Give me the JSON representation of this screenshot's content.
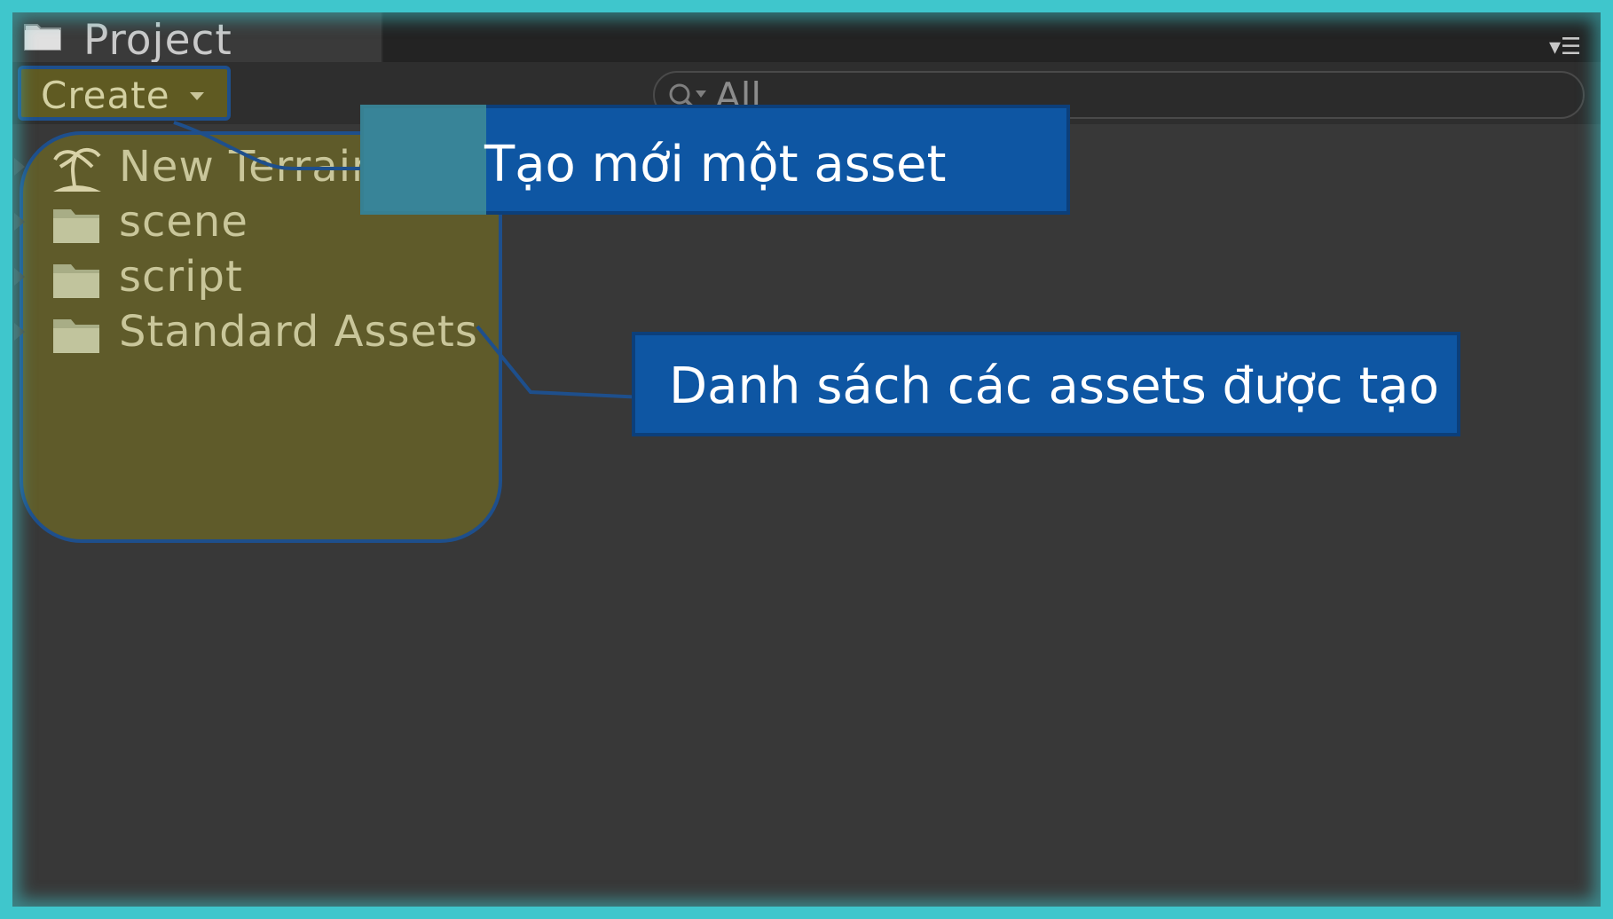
{
  "panel": {
    "tab_title": "Project",
    "tab_icon": "folder-icon",
    "menu_icon": "dropdown-menu-icon"
  },
  "toolbar": {
    "create_label": "Create",
    "search_placeholder": "All",
    "search_icon": "search-icon"
  },
  "assets": {
    "items": [
      {
        "label": "New Terrain",
        "icon": "terrain-icon",
        "has_children": true
      },
      {
        "label": "scene",
        "icon": "folder-icon",
        "has_children": true
      },
      {
        "label": "script",
        "icon": "folder-icon",
        "has_children": true
      },
      {
        "label": "Standard Assets",
        "icon": "folder-icon",
        "has_children": true
      }
    ]
  },
  "annotations": {
    "create_callout": "Tạo mới một asset",
    "list_callout": "Danh sách các assets được tạo"
  },
  "colors": {
    "frame": "#3fc6cc",
    "callout_bg": "#0e56a3",
    "highlight": "#5f5b2a",
    "panel_bg": "#383838"
  }
}
